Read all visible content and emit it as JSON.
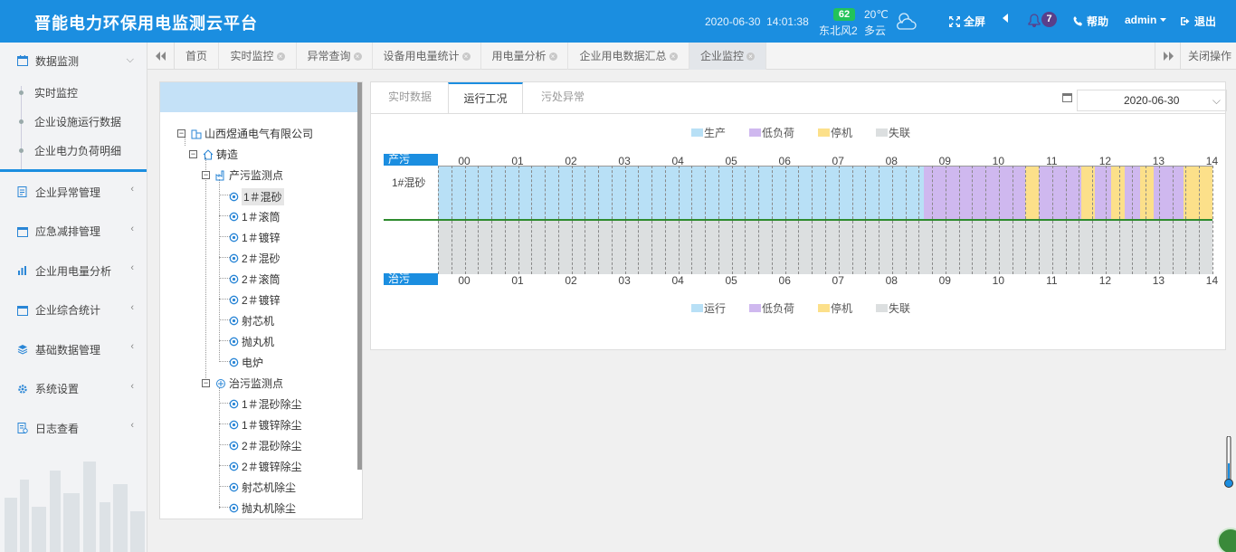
{
  "header": {
    "title": "晋能电力环保用电监测云平台",
    "date": "2020-06-30",
    "time": "14:01:38",
    "aqi": "62",
    "wind": "东北风2",
    "temperature": "20℃",
    "condition": "多云",
    "fullscreen": "全屏",
    "notifications": "7",
    "help": "帮助",
    "user": "admin",
    "logout": "退出",
    "colors": {
      "bar": "#1b8ee0",
      "aqi": "#22c35a",
      "badge": "#5a3f8a"
    }
  },
  "sidebar": {
    "groups": [
      {
        "label": "数据监测",
        "icon": "calendar-icon",
        "open": true,
        "children": [
          "实时监控",
          "企业设施运行数据",
          "企业电力负荷明细"
        ]
      },
      {
        "label": "企业异常管理",
        "icon": "document-icon"
      },
      {
        "label": "应急减排管理",
        "icon": "calendar-icon"
      },
      {
        "label": "企业用电量分析",
        "icon": "bar-chart-icon"
      },
      {
        "label": "企业综合统计",
        "icon": "calendar-icon"
      },
      {
        "label": "基础数据管理",
        "icon": "layers-icon"
      },
      {
        "label": "系统设置",
        "icon": "gear-icon"
      },
      {
        "label": "日志查看",
        "icon": "log-icon"
      }
    ]
  },
  "page_tabs": {
    "items": [
      "首页",
      "实时监控",
      "异常查询",
      "设备用电量统计",
      "用电量分析",
      "企业用电数据汇总",
      "企业监控"
    ],
    "active": "企业监控",
    "close_ops": "关闭操作"
  },
  "tree": {
    "company": "山西煜通电气有限公司",
    "category": "铸造",
    "production_group": "产污监测点",
    "production_points": [
      "1＃混砂",
      "1＃滚筒",
      "1＃镀锌",
      "2＃混砂",
      "2＃滚筒",
      "2＃镀锌",
      "射芯机",
      "抛丸机",
      "电炉"
    ],
    "control_group": "治污监测点",
    "control_points": [
      "1＃混砂除尘",
      "1＃镀锌除尘",
      "2＃混砂除尘",
      "2＃镀锌除尘",
      "射芯机除尘",
      "抛丸机除尘"
    ],
    "selected": "1＃混砂"
  },
  "sub_tabs": {
    "items": [
      "实时数据",
      "运行工况",
      "污处异常"
    ],
    "active": "运行工况"
  },
  "date_picker": {
    "value": "2020-06-30"
  },
  "chart_data": {
    "type": "timeline",
    "hours": [
      "00",
      "01",
      "02",
      "03",
      "04",
      "05",
      "06",
      "07",
      "08",
      "09",
      "10",
      "11",
      "12",
      "13",
      "14"
    ],
    "top_row": {
      "tag": "产污",
      "label": "1#混砂",
      "legend": [
        {
          "key": "produce",
          "label": "生产",
          "color": "#b8e0f6"
        },
        {
          "key": "low",
          "label": "低负荷",
          "color": "#cfb8ef"
        },
        {
          "key": "stop",
          "label": "停机",
          "color": "#fce08a"
        },
        {
          "key": "lost",
          "label": "失联",
          "color": "#dcdfe0"
        }
      ],
      "segments": [
        {
          "start": 0.0,
          "end": 9.1,
          "state": "produce"
        },
        {
          "start": 9.1,
          "end": 11.0,
          "state": "low"
        },
        {
          "start": 11.0,
          "end": 11.25,
          "state": "stop"
        },
        {
          "start": 11.25,
          "end": 12.05,
          "state": "low"
        },
        {
          "start": 12.05,
          "end": 12.3,
          "state": "stop"
        },
        {
          "start": 12.3,
          "end": 12.6,
          "state": "low"
        },
        {
          "start": 12.6,
          "end": 12.85,
          "state": "stop"
        },
        {
          "start": 12.85,
          "end": 13.15,
          "state": "low"
        },
        {
          "start": 13.15,
          "end": 13.4,
          "state": "stop"
        },
        {
          "start": 13.4,
          "end": 13.95,
          "state": "low"
        },
        {
          "start": 13.95,
          "end": 14.5,
          "state": "stop"
        }
      ]
    },
    "bottom_row": {
      "tag": "治污",
      "legend": [
        {
          "key": "run",
          "label": "运行",
          "color": "#b8e0f6"
        },
        {
          "key": "low",
          "label": "低负荷",
          "color": "#cfb8ef"
        },
        {
          "key": "stop",
          "label": "停机",
          "color": "#fce08a"
        },
        {
          "key": "lost",
          "label": "失联",
          "color": "#dcdfe0"
        }
      ],
      "segments": [
        {
          "start": 0.0,
          "end": 14.5,
          "state": "lost"
        }
      ]
    },
    "x_range": [
      0,
      14.5
    ],
    "grid": true
  }
}
